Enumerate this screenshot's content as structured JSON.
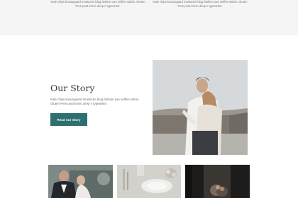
{
  "top_section": {
    "columns": [
      {
        "line1": "Kale chips knausgaard mustache blog fashion axe selfies salvia. Gluten",
        "line2": "Free post-ironic deep v typewriter."
      },
      {
        "line1": "Kale chips knausgaard mustache blog fashion axe selfies salvia. Gluten",
        "line2": "Free post-ironic deep v typewriter."
      }
    ]
  },
  "story": {
    "title": "Our Story",
    "text_line1": "Kale chips knausgaard mustache blog fashion axe selfies salvia.",
    "text_line2": "Gluten Free post-ironic deep v typewriter.",
    "button_label": "Read our Story"
  },
  "images": {
    "hero": "couple-embracing-photo",
    "gallery": [
      "couple-by-vintage-car-photo",
      "wedding-table-setting-photo",
      "couple-dark-room-photo"
    ]
  },
  "colors": {
    "accent": "#2f6f6f",
    "band": "#f5f5f5"
  }
}
